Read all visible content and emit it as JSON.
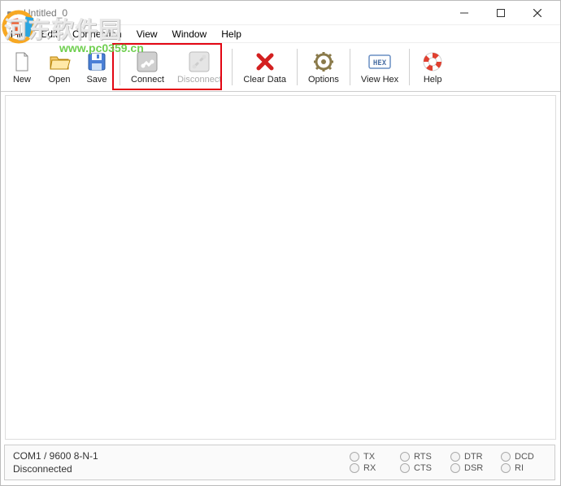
{
  "window": {
    "title": "Untitled_0"
  },
  "menu": {
    "items": [
      "File",
      "Edit",
      "Connection",
      "View",
      "Window",
      "Help"
    ]
  },
  "toolbar": {
    "new": "New",
    "open": "Open",
    "save": "Save",
    "connect": "Connect",
    "disconnect": "Disconnect",
    "clear_data": "Clear Data",
    "options": "Options",
    "view_hex": "View Hex",
    "help": "Help"
  },
  "status": {
    "port": "COM1 / 9600 8-N-1",
    "state": "Disconnected",
    "indicators": {
      "tx": "TX",
      "rx": "RX",
      "rts": "RTS",
      "cts": "CTS",
      "dtr": "DTR",
      "dsr": "DSR",
      "dcd": "DCD",
      "ri": "RI"
    }
  },
  "watermark": {
    "text": "河东软件园",
    "url": "www.pc0359.cn"
  }
}
